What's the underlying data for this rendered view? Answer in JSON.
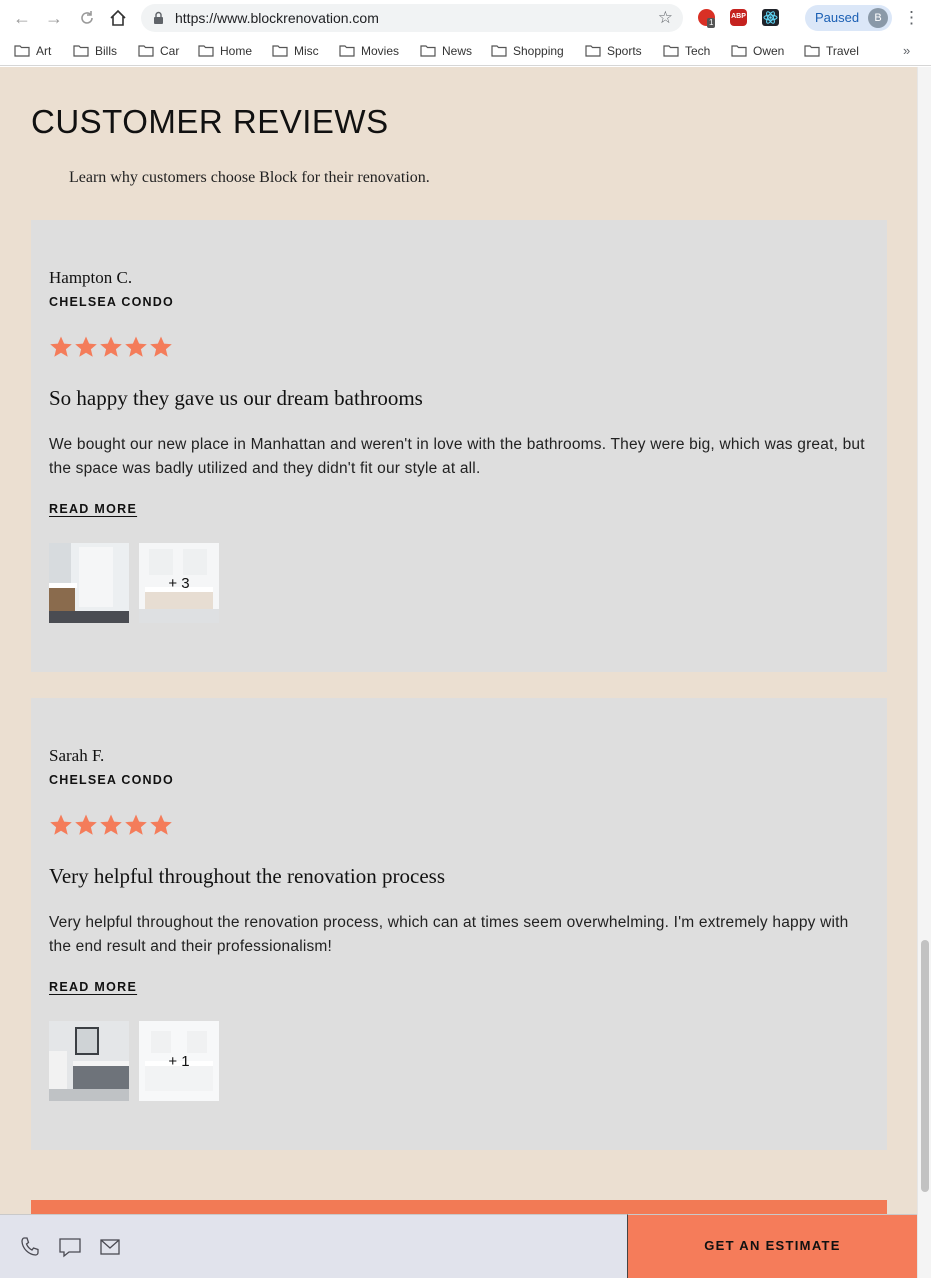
{
  "browser": {
    "url": "https://www.blockrenovation.com",
    "profile_status": "Paused",
    "profile_initial": "B",
    "extension_badge": "1",
    "abp_label": "ABP",
    "bookmarks": [
      "Art",
      "Bills",
      "Car",
      "Home",
      "Misc",
      "Movies",
      "News",
      "Shopping",
      "Sports",
      "Tech",
      "Owen",
      "Travel"
    ],
    "bookmarks_more": "»"
  },
  "page": {
    "section_title": "CUSTOMER REVIEWS",
    "section_subtitle": "Learn why customers choose Block for their renovation.",
    "reviews": [
      {
        "name": "Hampton C.",
        "location": "CHELSEA CONDO",
        "rating": 5,
        "headline": "So happy they gave us our dream bathrooms",
        "body": "We bought our new place in Manhattan and weren't in love with the bathrooms. They were big, which was great, but the space was badly utilized and they didn't fit our style at all.",
        "read_more": "READ MORE",
        "more_photos": "+ 3"
      },
      {
        "name": "Sarah F.",
        "location": "CHELSEA CONDO",
        "rating": 5,
        "headline": "Very helpful throughout the renovation process",
        "body": "Very helpful throughout the renovation process, which can at times seem overwhelming. I'm extremely happy with the end result and their professionalism!",
        "read_more": "READ MORE",
        "more_photos": "+ 1"
      }
    ]
  },
  "footer": {
    "estimate_label": "GET AN ESTIMATE",
    "icons": [
      "phone-icon",
      "chat-icon",
      "mail-icon"
    ]
  },
  "colors": {
    "page_bg": "#ebdfd1",
    "card_bg": "#dedede",
    "star": "#f47c5a",
    "accent": "#f57c5a"
  }
}
